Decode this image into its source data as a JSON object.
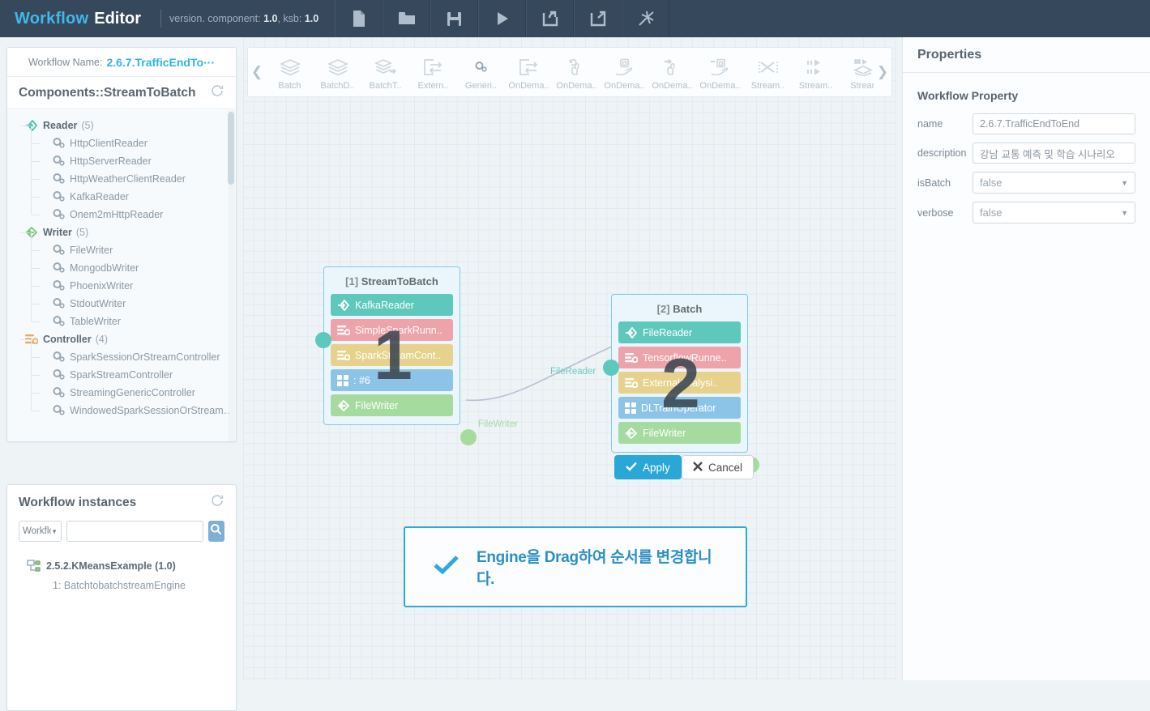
{
  "app": {
    "brand_primary": "Workflow",
    "brand_secondary": "Editor",
    "version_prefix": "version. component:",
    "version_component": "1.0",
    "version_ksb_label": ", ksb:",
    "version_ksb": "1.0",
    "accent": "#3fb9e8",
    "topbar_bg": "#36485c"
  },
  "toolbar": {
    "items": [
      {
        "name": "new-file-icon",
        "label": "New"
      },
      {
        "name": "open-folder-icon",
        "label": "Open"
      },
      {
        "name": "save-icon",
        "label": "Save"
      },
      {
        "name": "run-icon",
        "label": "Run"
      },
      {
        "name": "import-icon",
        "label": "Import"
      },
      {
        "name": "export-icon",
        "label": "Export"
      },
      {
        "name": "magic-wand-icon",
        "label": "Auto"
      }
    ]
  },
  "sidebar": {
    "workflow_name_label": "Workflow Name:",
    "workflow_name_value": "2.6.7.TrafficEndTo···",
    "components_title": "Components::StreamToBatch",
    "refresh_icon": "refresh-icon",
    "tree": [
      {
        "type": "group",
        "icon": "reader-arrow-icon",
        "label": "Reader",
        "count": "(5)"
      },
      {
        "type": "leaf",
        "icon": "gears-icon",
        "label": "HttpClientReader"
      },
      {
        "type": "leaf",
        "icon": "gears-icon",
        "label": "HttpServerReader"
      },
      {
        "type": "leaf",
        "icon": "gears-icon",
        "label": "HttpWeatherClientReader"
      },
      {
        "type": "leaf",
        "icon": "gears-icon",
        "label": "KafkaReader"
      },
      {
        "type": "leaf",
        "icon": "gears-icon",
        "label": "Onem2mHttpReader"
      },
      {
        "type": "group",
        "icon": "writer-arrow-icon",
        "label": "Writer",
        "count": "(5)"
      },
      {
        "type": "leaf",
        "icon": "gears-icon",
        "label": "FileWriter"
      },
      {
        "type": "leaf",
        "icon": "gears-icon",
        "label": "MongodbWriter"
      },
      {
        "type": "leaf",
        "icon": "gears-icon",
        "label": "PhoenixWriter"
      },
      {
        "type": "leaf",
        "icon": "gears-icon",
        "label": "StdoutWriter"
      },
      {
        "type": "leaf",
        "icon": "gears-icon",
        "label": "TableWriter"
      },
      {
        "type": "group",
        "icon": "controller-icon",
        "label": "Controller",
        "count": "(4)"
      },
      {
        "type": "leaf",
        "icon": "gears-icon",
        "label": "SparkSessionOrStreamController"
      },
      {
        "type": "leaf",
        "icon": "gears-icon",
        "label": "SparkStreamController"
      },
      {
        "type": "leaf",
        "icon": "gears-icon",
        "label": "StreamingGenericController"
      },
      {
        "type": "leaf",
        "icon": "gears-icon",
        "label": "WindowedSparkSessionOrStream…"
      }
    ]
  },
  "instances": {
    "title": "Workflow instances",
    "refresh_icon": "refresh-icon",
    "filter_value": "Workflow I",
    "search_value": "",
    "search_placeholder": "",
    "search_icon": "search-icon",
    "list": [
      {
        "icon": "workflow-instance-icon",
        "label": "2.5.2.KMeansExample (1.0)",
        "children": [
          {
            "label": "1: BatchtobatchstreamEngine"
          }
        ]
      }
    ]
  },
  "palette": {
    "prev_icon": "chevron-left-icon",
    "next_icon": "chevron-right-icon",
    "items": [
      {
        "icon": "stack-icon",
        "label": "Batch"
      },
      {
        "icon": "stack-icon",
        "label": "BatchD.."
      },
      {
        "icon": "stack-arrow-icon",
        "label": "BatchT.."
      },
      {
        "icon": "box-arrow-icon",
        "label": "Extern.."
      },
      {
        "icon": "gears-icon",
        "label": "Generi.."
      },
      {
        "icon": "box-arrow-icon",
        "label": "OnDema.."
      },
      {
        "icon": "hand-refresh-icon",
        "label": "OnDema.."
      },
      {
        "icon": "chip-hand-icon",
        "label": "OnDema.."
      },
      {
        "icon": "hand-arrow-icon",
        "label": "OnDema.."
      },
      {
        "icon": "chip-arrow-icon",
        "label": "OnDema.."
      },
      {
        "icon": "cross-arrows-icon",
        "label": "Stream.."
      },
      {
        "icon": "arrows-right-icon",
        "label": "Stream.."
      },
      {
        "icon": "stream-stack-icon",
        "label": "Strean"
      }
    ]
  },
  "canvas": {
    "nodes": [
      {
        "badge": "1",
        "title_index": "[1]",
        "title": "StreamToBatch",
        "rows": [
          {
            "icon": "reader-arrow-icon",
            "label": "KafkaReader",
            "color": "#5ec8bc"
          },
          {
            "icon": "controller-icon",
            "label": "SimpleSparkRunn..",
            "color": "#eda3a9"
          },
          {
            "icon": "controller-icon",
            "label": "SparkStreamCont..",
            "color": "#e6d28c"
          },
          {
            "icon": "operator-icon",
            "label": ": #6",
            "color": "#8cc4e8"
          },
          {
            "icon": "writer-arrow-icon",
            "label": "FileWriter",
            "color": "#a6dba0"
          }
        ]
      },
      {
        "badge": "2",
        "title_index": "[2]",
        "title": "Batch",
        "rows": [
          {
            "icon": "reader-arrow-icon",
            "label": "FileReader",
            "color": "#5ec8bc"
          },
          {
            "icon": "controller-icon",
            "label": "TensorflowRunne..",
            "color": "#eda3a9"
          },
          {
            "icon": "controller-icon",
            "label": "ExternalAnalysi..",
            "color": "#e6d28c"
          },
          {
            "icon": "operator-icon",
            "label": "DLTrainOperator",
            "color": "#8cc4e8"
          },
          {
            "icon": "writer-arrow-icon",
            "label": "FileWriter",
            "color": "#a6dba0"
          }
        ]
      }
    ],
    "edge_labels": [
      {
        "label": "FileWriter",
        "color": "#a6dba0"
      },
      {
        "label": "FileReader",
        "color": "#5ec8bc"
      }
    ],
    "apply_label": "Apply",
    "apply_icon": "check-icon",
    "cancel_label": "Cancel",
    "cancel_icon": "cross-icon",
    "info_icon": "check-icon",
    "info_text": "Engine을 Drag하여 순서를 변경합니다."
  },
  "properties": {
    "title": "Properties",
    "section": "Workflow Property",
    "fields": [
      {
        "label": "name",
        "type": "input",
        "value": "2.6.7.TrafficEndToEnd"
      },
      {
        "label": "description",
        "type": "input",
        "value": "강남 교통 예측 및 학습 시나리오"
      },
      {
        "label": "isBatch",
        "type": "select",
        "value": "false"
      },
      {
        "label": "verbose",
        "type": "select",
        "value": "false"
      }
    ]
  }
}
